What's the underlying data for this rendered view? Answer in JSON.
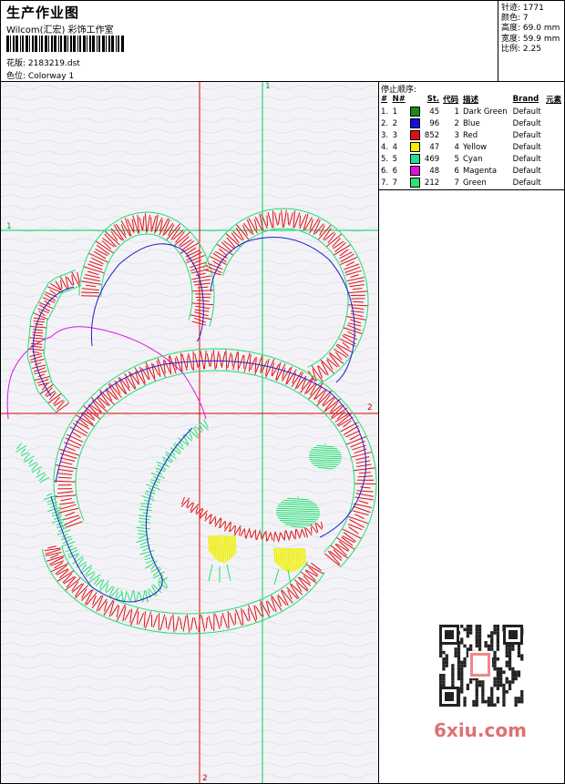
{
  "header": {
    "title": "生产作业图",
    "company": "Wilcom(汇宏) 彩饰工作室",
    "design_label": "花版:",
    "design_file": "2183219.dst",
    "colorway_label": "色位:",
    "colorway": "Colorway 1"
  },
  "stats": {
    "stitches_label": "针迹:",
    "stitches": "1771",
    "colors_label": "颜色:",
    "colors": "7",
    "height_label": "高度:",
    "height": "69.0 mm",
    "width_label": "宽度:",
    "width": "59.9 mm",
    "scale_label": "比例:",
    "scale": "2.25"
  },
  "panel": {
    "stop_sequence_title": "停止顺序:",
    "columns": [
      "#",
      "N#",
      "St.",
      "代码",
      "描述",
      "Brand",
      "元素"
    ],
    "threads": [
      {
        "idx": "1.",
        "n": "1",
        "st": "45",
        "code": "1",
        "desc": "Dark Green",
        "brand": "Default",
        "color": "#1a8a1a"
      },
      {
        "idx": "2.",
        "n": "2",
        "st": "96",
        "code": "2",
        "desc": "Blue",
        "brand": "Default",
        "color": "#1010e0"
      },
      {
        "idx": "3.",
        "n": "3",
        "st": "852",
        "code": "3",
        "desc": "Red",
        "brand": "Default",
        "color": "#e01010"
      },
      {
        "idx": "4.",
        "n": "4",
        "st": "47",
        "code": "4",
        "desc": "Yellow",
        "brand": "Default",
        "color": "#f0f000"
      },
      {
        "idx": "5.",
        "n": "5",
        "st": "469",
        "code": "5",
        "desc": "Cyan",
        "brand": "Default",
        "color": "#20e090"
      },
      {
        "idx": "6.",
        "n": "6",
        "st": "48",
        "code": "6",
        "desc": "Magenta",
        "brand": "Default",
        "color": "#e010e0"
      },
      {
        "idx": "7.",
        "n": "7",
        "st": "212",
        "code": "7",
        "desc": "Green",
        "brand": "Default",
        "color": "#30e070"
      }
    ]
  },
  "guides": {
    "vertical_red_label": "2",
    "horizontal_red_label": "2",
    "vertical_green_label": "1",
    "horizontal_green_label": "1"
  },
  "watermark": "6xiu.com",
  "colors": {
    "red_guide": "#e00000",
    "green_guide": "#00d060",
    "stitch_red": "#e01010",
    "stitch_green": "#20e070",
    "stitch_blue": "#2020d0",
    "stitch_magenta": "#e010e0",
    "stitch_yellow": "#f0f000"
  }
}
